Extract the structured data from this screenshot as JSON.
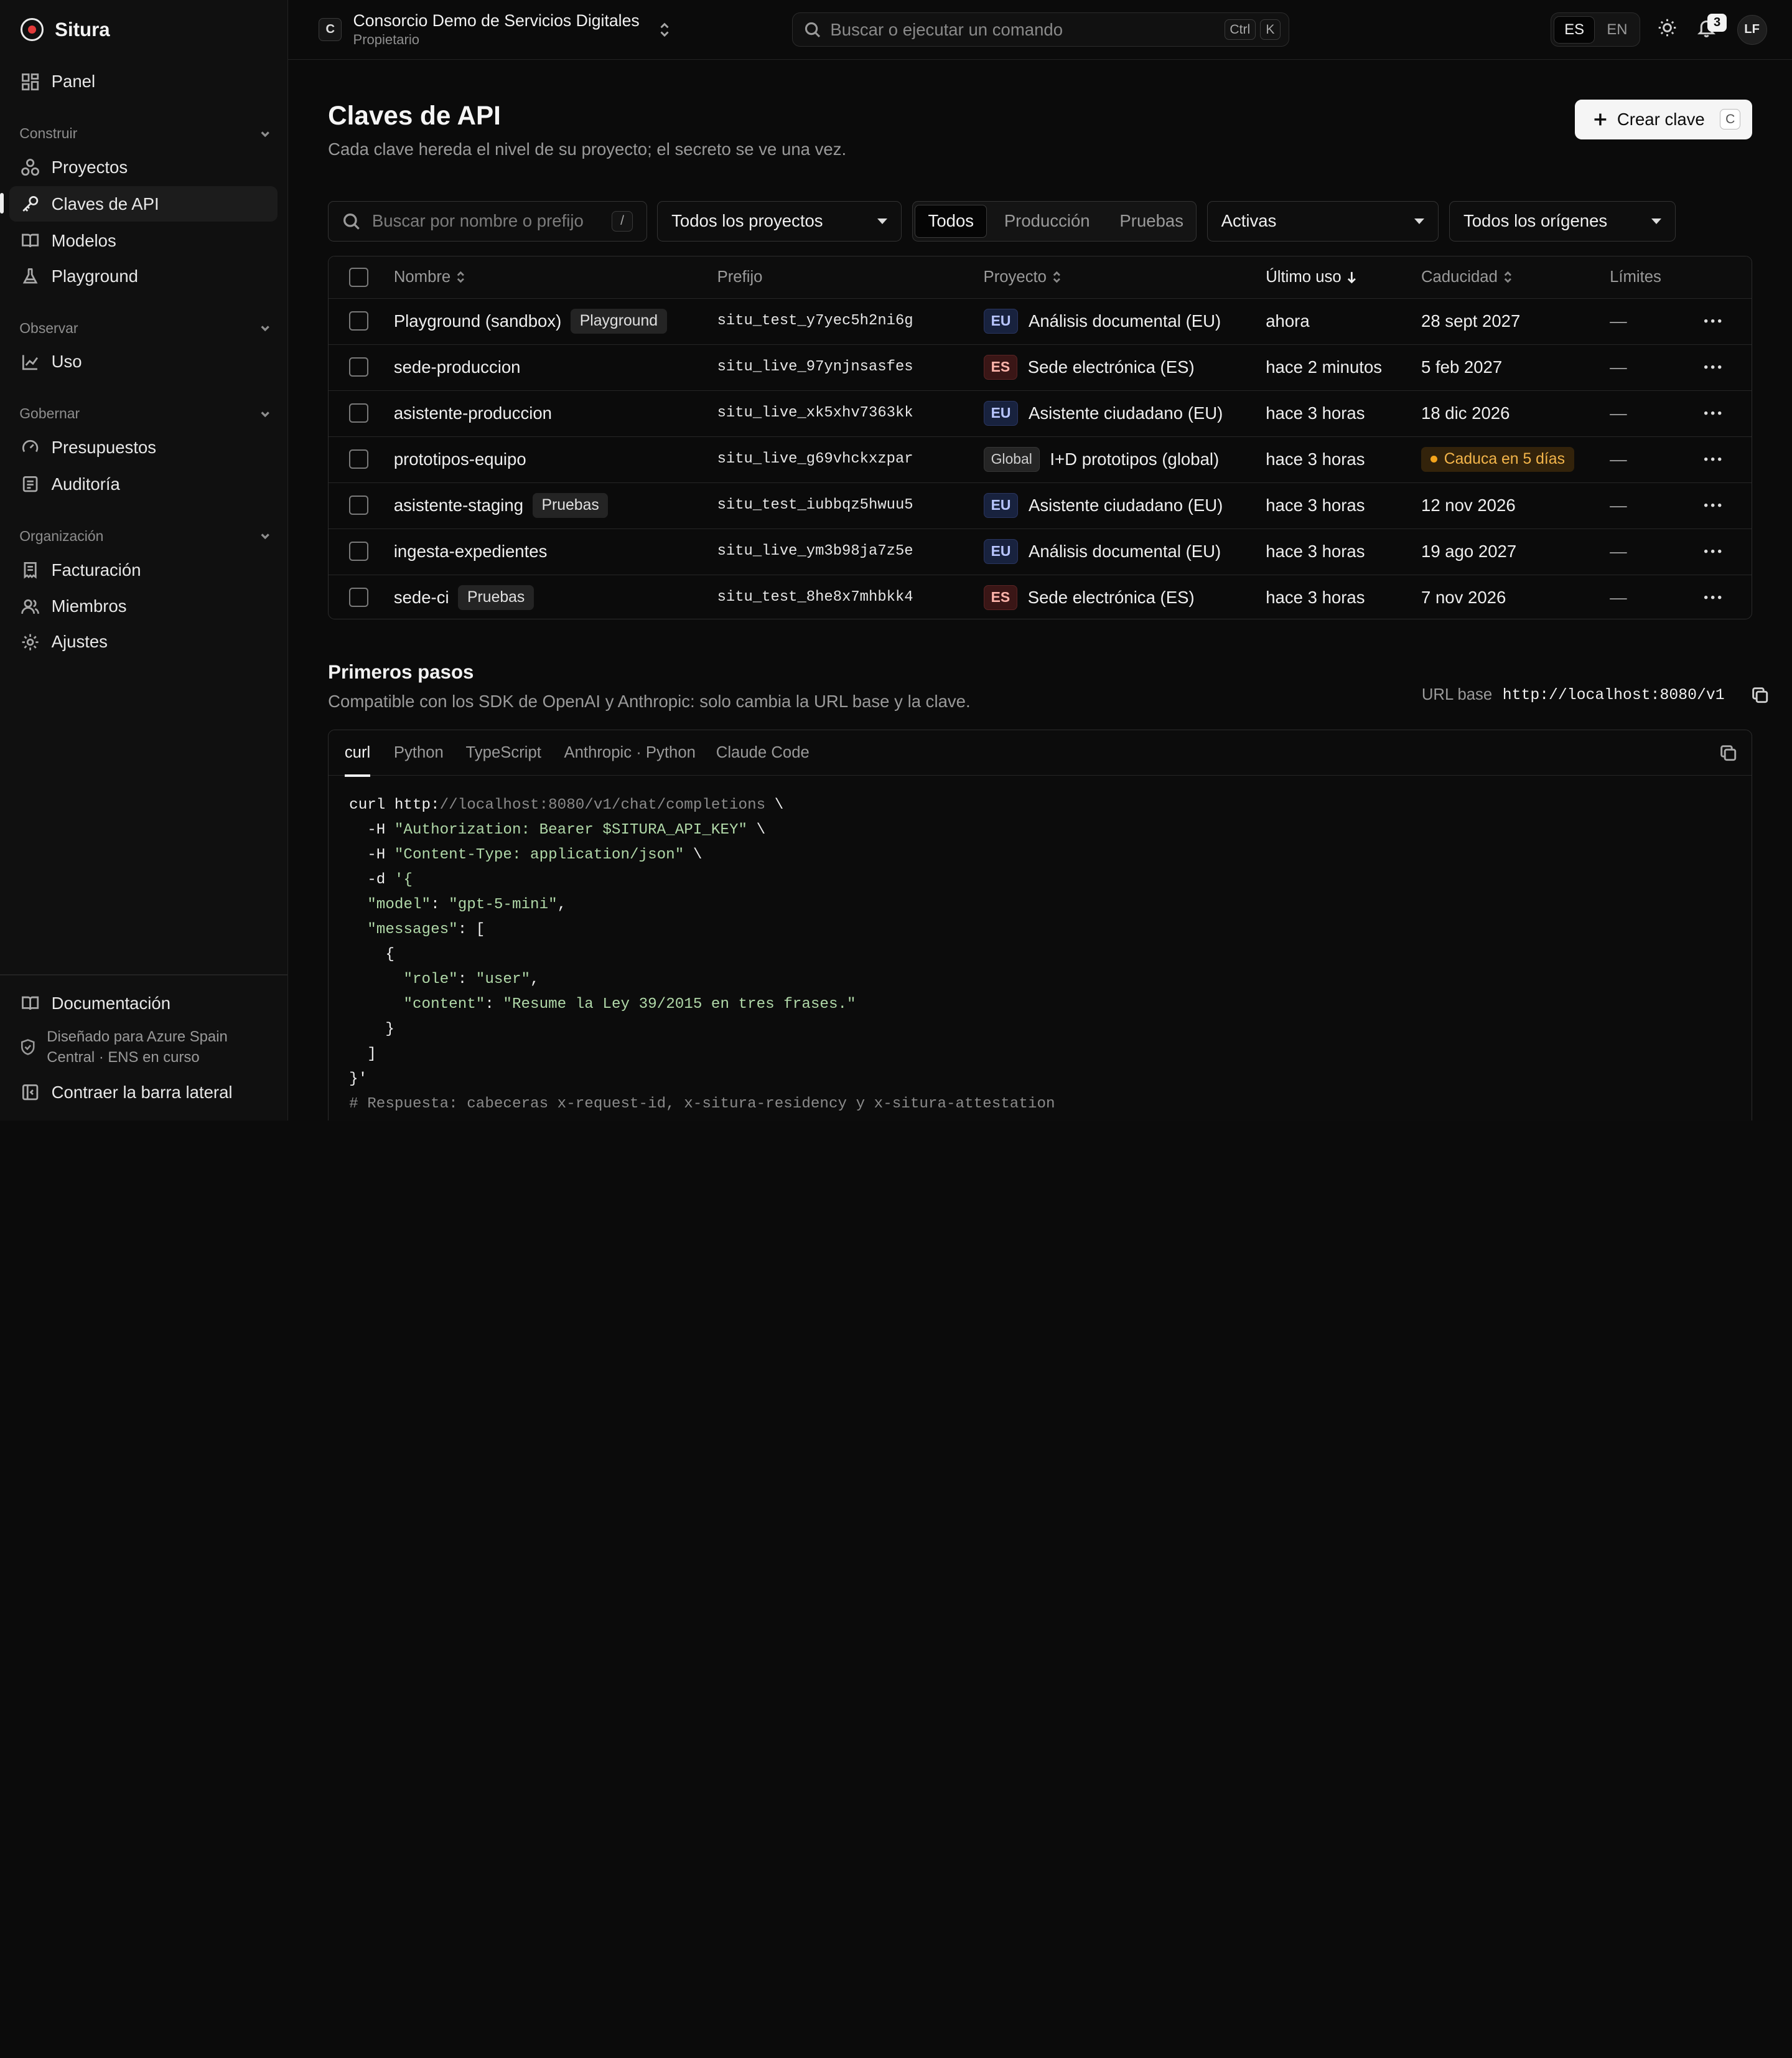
{
  "app": {
    "name": "Situra"
  },
  "sidebar": {
    "top_item": "Panel",
    "sections": [
      {
        "title": "Construir",
        "items": [
          "Proyectos",
          "Claves de API",
          "Modelos",
          "Playground"
        ]
      },
      {
        "title": "Observar",
        "items": [
          "Uso"
        ]
      },
      {
        "title": "Gobernar",
        "items": [
          "Presupuestos",
          "Auditoría"
        ]
      },
      {
        "title": "Organización",
        "items": [
          "Facturación",
          "Miembros",
          "Ajustes"
        ]
      }
    ],
    "active_item": "Claves de API",
    "footer": {
      "docs": "Documentación",
      "note_line1": "Diseñado para Azure Spain",
      "note_line2": "Central · ENS en curso",
      "collapse": "Contraer la barra lateral"
    }
  },
  "header": {
    "org_initial": "C",
    "org_name": "Consorcio Demo de Servicios Digitales",
    "org_role": "Propietario",
    "search_placeholder": "Buscar o ejecutar un comando",
    "search_keys": [
      "Ctrl",
      "K"
    ],
    "languages": [
      "ES",
      "EN"
    ],
    "active_language": "ES",
    "notifications_count": "3",
    "user_initials": "LF"
  },
  "page": {
    "title": "Claves de API",
    "subtitle": "Cada clave hereda el nivel de su proyecto; el secreto se ve una vez.",
    "create_button": "Crear clave",
    "create_shortcut": "C"
  },
  "filters": {
    "search_placeholder": "Buscar por nombre o prefijo",
    "search_shortcut": "/",
    "project": "Todos los proyectos",
    "environments": [
      "Todos",
      "Producción",
      "Pruebas"
    ],
    "active_environment": "Todos",
    "status": "Activas",
    "origin": "Todos los orígenes"
  },
  "table": {
    "columns": [
      "Nombre",
      "Prefijo",
      "Proyecto",
      "Último uso",
      "Caducidad",
      "Límites"
    ],
    "sorted_column": "Último uso",
    "rows": [
      {
        "name": "Playground (sandbox)",
        "tag": "Playground",
        "prefix": "situ_test_y7yec5h2ni6g",
        "region": "EU",
        "region_kind": "eu",
        "project": "Análisis documental (EU)",
        "last_used": "ahora",
        "expiry": "28 sept 2027",
        "expiry_warning": false,
        "limits": "—"
      },
      {
        "name": "sede-produccion",
        "tag": "",
        "prefix": "situ_live_97ynjnsasfes",
        "region": "ES",
        "region_kind": "es",
        "project": "Sede electrónica (ES)",
        "last_used": "hace 2 minutos",
        "expiry": "5 feb 2027",
        "expiry_warning": false,
        "limits": "—"
      },
      {
        "name": "asistente-produccion",
        "tag": "",
        "prefix": "situ_live_xk5xhv7363kk",
        "region": "EU",
        "region_kind": "eu",
        "project": "Asistente ciudadano (EU)",
        "last_used": "hace 3 horas",
        "expiry": "18 dic 2026",
        "expiry_warning": false,
        "limits": "—"
      },
      {
        "name": "prototipos-equipo",
        "tag": "",
        "prefix": "situ_live_g69vhckxzpar",
        "region": "Global",
        "region_kind": "gl",
        "project": "I+D prototipos (global)",
        "last_used": "hace 3 horas",
        "expiry": "Caduca en 5 días",
        "expiry_warning": true,
        "limits": "—"
      },
      {
        "name": "asistente-staging",
        "tag": "Pruebas",
        "prefix": "situ_test_iubbqz5hwuu5",
        "region": "EU",
        "region_kind": "eu",
        "project": "Asistente ciudadano (EU)",
        "last_used": "hace 3 horas",
        "expiry": "12 nov 2026",
        "expiry_warning": false,
        "limits": "—"
      },
      {
        "name": "ingesta-expedientes",
        "tag": "",
        "prefix": "situ_live_ym3b98ja7z5e",
        "region": "EU",
        "region_kind": "eu",
        "project": "Análisis documental (EU)",
        "last_used": "hace 3 horas",
        "expiry": "19 ago 2027",
        "expiry_warning": false,
        "limits": "—"
      },
      {
        "name": "sede-ci",
        "tag": "Pruebas",
        "prefix": "situ_test_8he8x7mhbkk4",
        "region": "ES",
        "region_kind": "es",
        "project": "Sede electrónica (ES)",
        "last_used": "hace 3 horas",
        "expiry": "7 nov 2026",
        "expiry_warning": false,
        "limits": "—"
      }
    ]
  },
  "quickstart": {
    "title": "Primeros pasos",
    "subtitle": "Compatible con los SDK de OpenAI y Anthropic: solo cambia la URL base y la clave.",
    "base_url_label": "URL base",
    "base_url": "http://localhost:8080/v1",
    "tabs": [
      "curl",
      "Python",
      "TypeScript",
      "Anthropic · Python",
      "Claude Code"
    ],
    "active_tab": "curl",
    "code_lines": [
      "curl http://localhost:8080/v1/chat/completions \\",
      "  -H \"Authorization: Bearer $SITURA_API_KEY\" \\",
      "  -H \"Content-Type: application/json\" \\",
      "  -d '{",
      "  \"model\": \"gpt-5-mini\",",
      "  \"messages\": [",
      "    {",
      "      \"role\": \"user\",",
      "      \"content\": \"Resume la Ley 39/2015 en tres frases.\"",
      "    }",
      "  ]",
      "}'",
      "# Respuesta: cabeceras x-request-id, x-situra-residency y x-situra-attestation"
    ]
  }
}
